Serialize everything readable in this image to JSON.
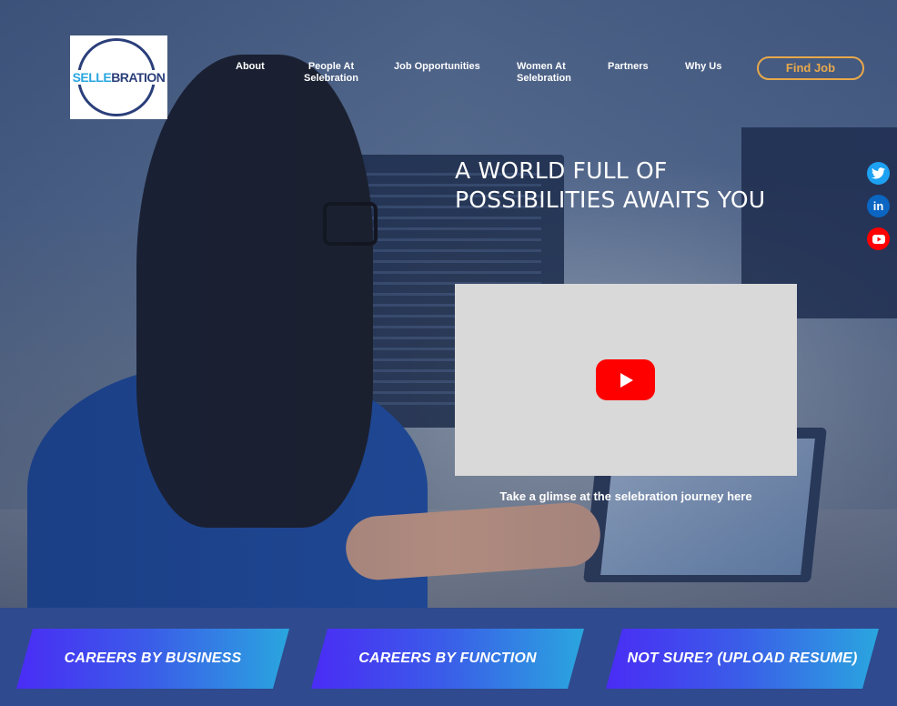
{
  "brand": {
    "logo_prefix": "SELLE",
    "logo_suffix": "BRATION"
  },
  "nav": {
    "about": "About",
    "people_line1": "People At",
    "people_line2": "Selebration",
    "jobs": "Job Opportunities",
    "women_line1": "Women At",
    "women_line2": "Selebration",
    "partners": "Partners",
    "why_us": "Why Us",
    "find_job": "Find Job"
  },
  "hero": {
    "headline_line1": "A WORLD FULL OF",
    "headline_line2": "POSSIBILITIES AWAITS YOU",
    "video_caption": "Take a glimse at the selebration journey here"
  },
  "social": {
    "twitter": "twitter-icon",
    "linkedin": "linkedin-icon",
    "youtube": "youtube-icon"
  },
  "ctas": {
    "business": "CAREERS BY BUSINESS",
    "function": "CAREERS BY FUNCTION",
    "resume": "NOT SURE? (UPLOAD RESUME)"
  },
  "colors": {
    "accent": "#e8a94a",
    "cta_gradient_start": "#4a2cf5",
    "cta_gradient_end": "#2aa6df",
    "bottom_bar": "#2f4a8e"
  }
}
